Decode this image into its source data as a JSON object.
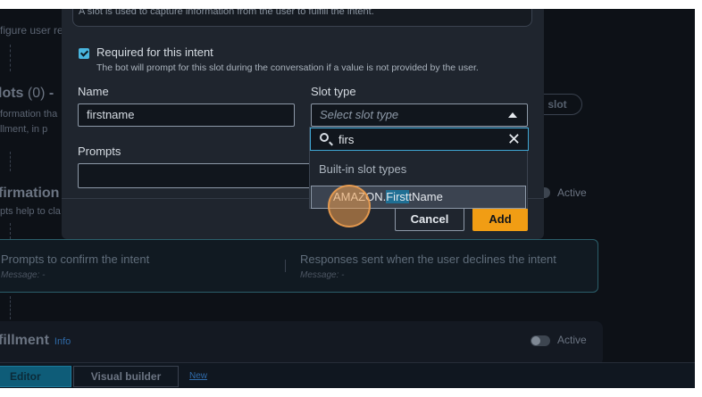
{
  "background": {
    "intent_desc_left": "figure user rec",
    "slots_heading": "lots",
    "slots_count": "(0)",
    "slots_dash": "-",
    "slots_sub1": "formation tha",
    "slots_sub2": "llment, in p",
    "add_slot_label": "slot",
    "confirmation_heading": "firmation",
    "confirmation_sub": "pts help to cla",
    "confirmation_toggle_label": "Active",
    "confirm_prompts_title": "Prompts to confirm the intent",
    "confirm_prompts_sub": "Message: -",
    "decline_title": "Responses sent when the user declines the intent",
    "decline_sub": "Message: -",
    "fulfillment_heading": "fillment",
    "fulfillment_info": "Info",
    "fulfillment_toggle_label": "Active",
    "tabs": {
      "editor": "Editor",
      "visual_builder": "Visual builder",
      "new_badge": "New"
    }
  },
  "modal": {
    "description_text": "A slot is used to capture information from the user to fulfill the intent.",
    "required": {
      "label": "Required for this intent",
      "help": "The bot will prompt for this slot during the conversation if a value is not provided by the user."
    },
    "name": {
      "label": "Name",
      "value": "firstname"
    },
    "slot_type": {
      "label": "Slot type",
      "placeholder": "Select slot type"
    },
    "prompts": {
      "label": "Prompts"
    },
    "buttons": {
      "cancel": "Cancel",
      "add": "Add"
    }
  },
  "dropdown": {
    "search_value": "firs",
    "group_label": "Built-in slot types",
    "option_prefix": "AMAZON.",
    "option_match": "First",
    "option_suffix": "tName"
  },
  "colors": {
    "accent": "#f19d14",
    "focus": "#3fa7d4",
    "highlight": "#1f6f94"
  }
}
